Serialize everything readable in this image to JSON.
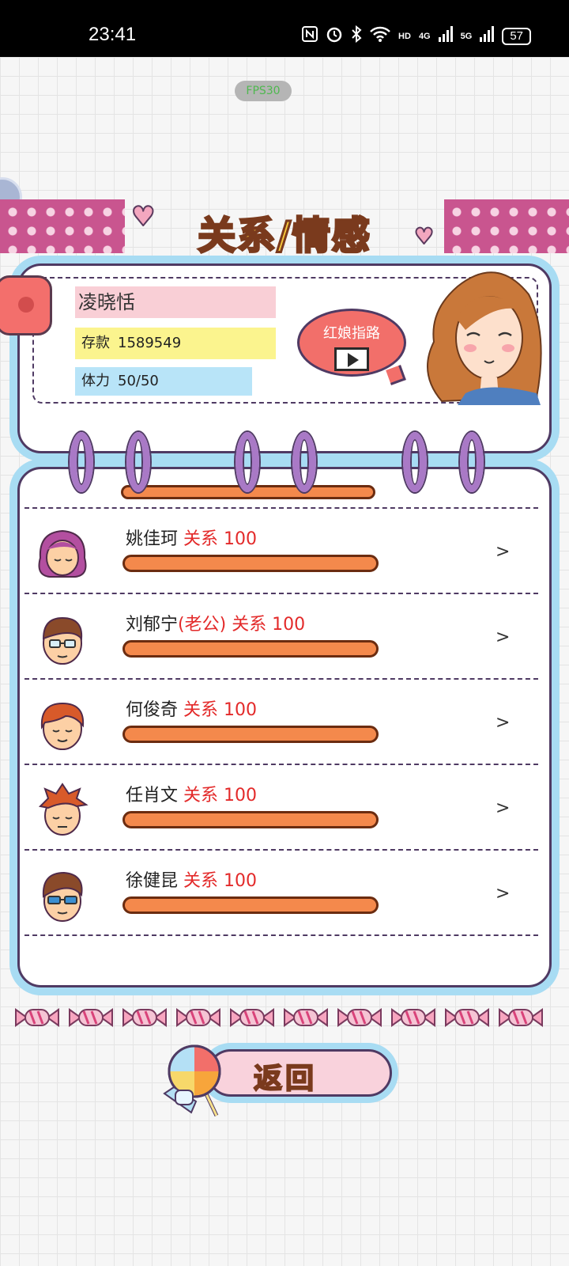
{
  "status_bar": {
    "time": "23:41",
    "icons": [
      "nfc-icon",
      "alarm-icon",
      "bluetooth-icon",
      "wifi-icon",
      "hd-icon",
      "signal-4g-icon",
      "signal-5g-icon"
    ],
    "hd_label": "HD",
    "sig4": "4G",
    "sig5": "5G",
    "battery": "57"
  },
  "fps_label": "FPS30",
  "header": {
    "title": "关系/情感"
  },
  "profile": {
    "name": "凌晓恬",
    "money_label": "存款",
    "money_value": "1589549",
    "stamina_label": "体力",
    "stamina_value": "50/50",
    "guide_label": "红娘指路"
  },
  "relationships": [
    {
      "name": "姚佳珂",
      "relation_text": "关系 100",
      "relation_value": 100,
      "avatar": "woman-purple-hair-avatar"
    },
    {
      "name": "刘郁宁",
      "tag": "(老公)",
      "relation_text": "关系 100",
      "relation_value": 100,
      "avatar": "man-glasses-avatar"
    },
    {
      "name": "何俊奇",
      "relation_text": "关系 100",
      "relation_value": 100,
      "avatar": "man-red-hair-avatar"
    },
    {
      "name": "任肖文",
      "relation_text": "关系 100",
      "relation_value": 100,
      "avatar": "man-spiky-hair-avatar"
    },
    {
      "name": "徐健昆",
      "relation_text": "关系 100",
      "relation_value": 100,
      "avatar": "man-sunglasses-avatar"
    }
  ],
  "arrow": ">",
  "back_button": {
    "label": "返回"
  },
  "colors": {
    "accent_red": "#e32a2a",
    "bar_orange": "#f4894c",
    "frame_blue": "#a8dcf3"
  }
}
